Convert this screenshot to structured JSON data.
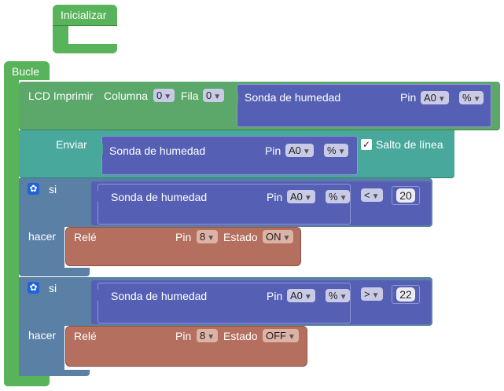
{
  "init_block": {
    "label": "Inicializar"
  },
  "loop_block": {
    "label": "Bucle"
  },
  "lcd_print": {
    "label": "LCD Imprimir",
    "column_label": "Columna",
    "column_value": "0",
    "row_label": "Fila",
    "row_value": "0",
    "sensor": {
      "label": "Sonda de humedad",
      "pin_label": "Pin",
      "pin_value": "A0",
      "unit_value": "%"
    }
  },
  "send_block": {
    "label": "Enviar",
    "sensor": {
      "label": "Sonda de humedad",
      "pin_label": "Pin",
      "pin_value": "A0",
      "unit_value": "%"
    },
    "newline_label": "Salto de línea",
    "newline_checked": true
  },
  "if_blocks": [
    {
      "if_label": "si",
      "do_label": "hacer",
      "sensor": {
        "label": "Sonda de humedad",
        "pin_label": "Pin",
        "pin_value": "A0",
        "unit_value": "%"
      },
      "operator": "<",
      "threshold": "20",
      "relay": {
        "label": "Relé",
        "pin_label": "Pin",
        "pin_value": "8",
        "state_label": "Estado",
        "state_value": "ON"
      }
    },
    {
      "if_label": "si",
      "do_label": "hacer",
      "sensor": {
        "label": "Sonda de humedad",
        "pin_label": "Pin",
        "pin_value": "A0",
        "unit_value": "%"
      },
      "operator": ">",
      "threshold": "22",
      "relay": {
        "label": "Relé",
        "pin_label": "Pin",
        "pin_value": "8",
        "state_label": "Estado",
        "state_value": "OFF"
      }
    }
  ],
  "colors": {
    "event_green": "#58b35b",
    "lcd_green": "#5ba86a",
    "send_teal": "#48a89b",
    "logic_blue": "#5b80a6",
    "sensor_purple": "#5560b5",
    "relay_brown": "#b46f5e",
    "gear_blue": "#1f64d8"
  }
}
